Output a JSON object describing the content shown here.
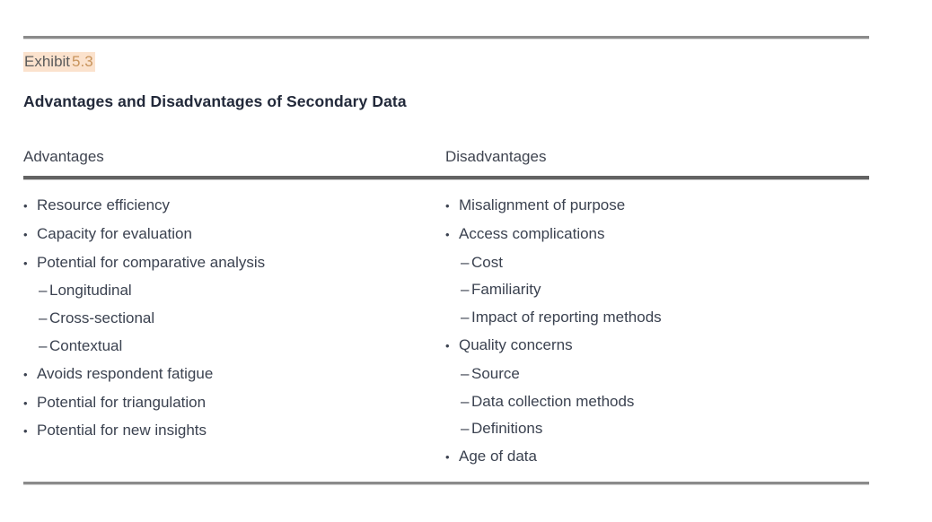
{
  "exhibit": {
    "label_word": "Exhibit",
    "label_number": "5.3",
    "title": "Advantages and Disadvantages of Secondary Data",
    "highlight_color": "#fbe2cd",
    "number_color": "#c8945c",
    "title_color": "#22293a",
    "rule_color": "#8b8b8b"
  },
  "table": {
    "columns": [
      {
        "header": "Advantages",
        "items": [
          {
            "level": 1,
            "marker": "•",
            "text": "Resource efficiency"
          },
          {
            "level": 1,
            "marker": "•",
            "text": "Capacity for evaluation"
          },
          {
            "level": 1,
            "marker": "•",
            "text": "Potential for comparative analysis"
          },
          {
            "level": 2,
            "marker": "–",
            "text": "Longitudinal"
          },
          {
            "level": 2,
            "marker": "–",
            "text": "Cross-sectional"
          },
          {
            "level": 2,
            "marker": "–",
            "text": "Contextual"
          },
          {
            "level": 1,
            "marker": "•",
            "text": "Avoids respondent fatigue"
          },
          {
            "level": 1,
            "marker": "•",
            "text": "Potential for triangulation"
          },
          {
            "level": 1,
            "marker": "•",
            "text": "Potential for new insights"
          }
        ]
      },
      {
        "header": "Disadvantages",
        "items": [
          {
            "level": 1,
            "marker": "•",
            "text": "Misalignment of purpose"
          },
          {
            "level": 1,
            "marker": "•",
            "text": "Access complications"
          },
          {
            "level": 2,
            "marker": "–",
            "text": "Cost"
          },
          {
            "level": 2,
            "marker": "–",
            "text": "Familiarity"
          },
          {
            "level": 2,
            "marker": "–",
            "text": "Impact of reporting methods"
          },
          {
            "level": 1,
            "marker": "•",
            "text": "Quality concerns"
          },
          {
            "level": 2,
            "marker": "–",
            "text": "Source"
          },
          {
            "level": 2,
            "marker": "–",
            "text": "Data collection methods"
          },
          {
            "level": 2,
            "marker": "–",
            "text": "Definitions"
          },
          {
            "level": 1,
            "marker": "•",
            "text": "Age of data"
          }
        ]
      }
    ]
  }
}
